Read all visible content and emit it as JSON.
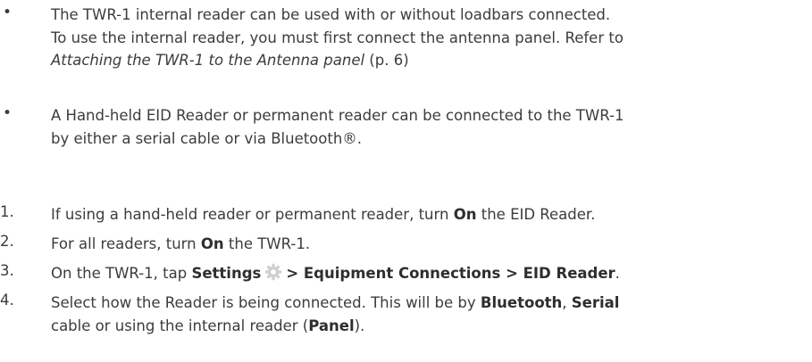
{
  "bullets": [
    {
      "marker": "•",
      "lines": [
        "The TWR-1 internal reader can be used with or without loadbars connected.",
        "To use the internal reader, you must first connect the antenna panel. Refer to"
      ],
      "ref_italic": "Attaching the TWR-1 to the Antenna panel",
      "ref_suffix": " (p. 6)"
    },
    {
      "marker": "•",
      "lines": [
        "A Hand-held EID Reader or permanent reader can be connected to the TWR-1",
        "by either a serial cable or via Bluetooth®."
      ]
    }
  ],
  "steps": [
    {
      "number": "1.",
      "pre": "If using a hand-held reader or permanent reader, turn ",
      "bold": "On",
      "post": " the EID Reader."
    },
    {
      "number": "2.",
      "pre": "For all readers, turn ",
      "bold": "On",
      "post": " the TWR-1."
    },
    {
      "number": "3.",
      "pre": "On the TWR-1, tap ",
      "bold_settings": "Settings",
      "icon": "gear-icon",
      "bold_path": "> Equipment Connections > EID Reader",
      "post": "."
    },
    {
      "number": "4.",
      "line1_pre": "Select how the Reader is being connected. This will be by ",
      "bold_bluetooth": "Bluetooth",
      "sep": ", ",
      "bold_serial": "Serial",
      "line2_pre": "cable or using the internal reader (",
      "bold_panel": "Panel",
      "line2_post": ")."
    }
  ]
}
